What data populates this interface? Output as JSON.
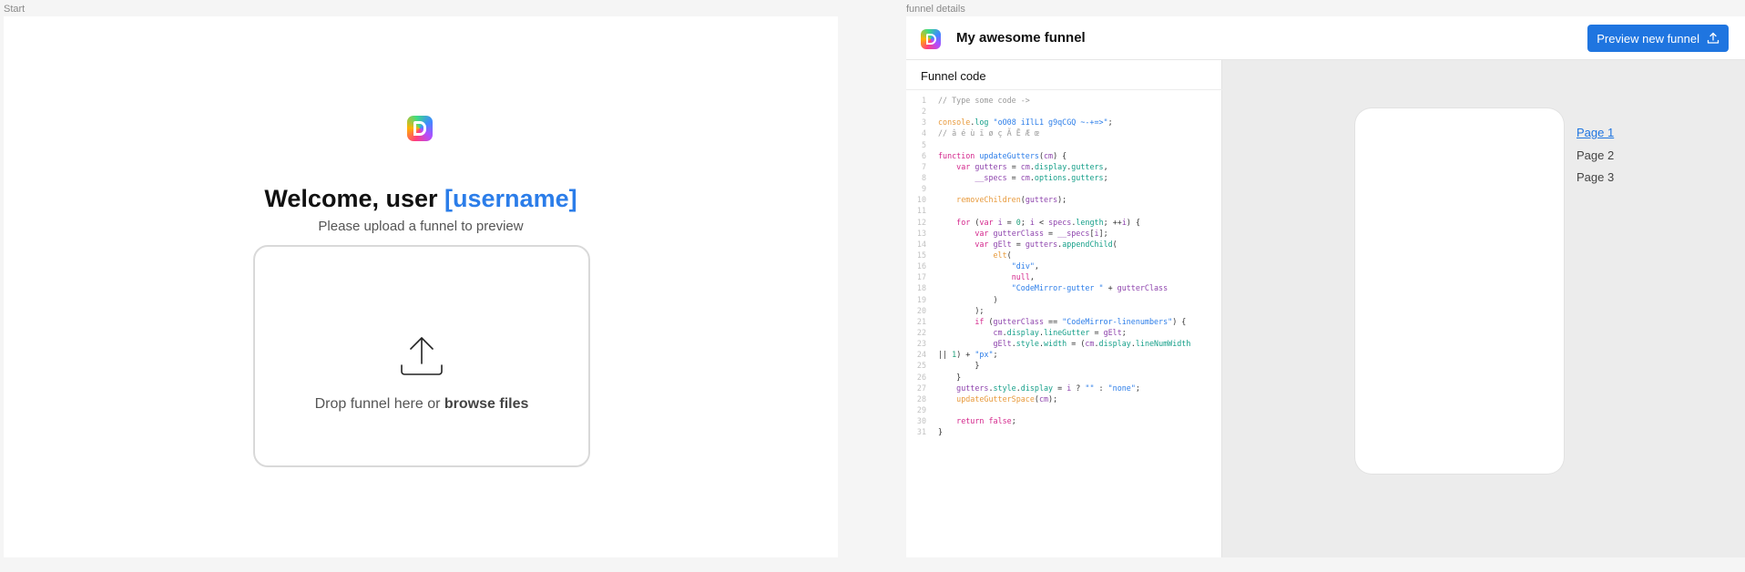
{
  "start": {
    "frame_label": "Start",
    "welcome_prefix": "Welcome, user",
    "username": "[username]",
    "subtitle": "Please upload a funnel to preview",
    "dropzone": {
      "text_prefix": "Drop funnel here or ",
      "browse_label": "browse files"
    }
  },
  "details": {
    "frame_label": "funnel details",
    "title": "My awesome funnel",
    "preview_button_label": "Preview new funnel",
    "code_panel_title": "Funnel code",
    "pages": [
      "Page 1",
      "Page 2",
      "Page 3"
    ],
    "active_page": "Page 1"
  },
  "code_lines": [
    "// Type some code ->",
    "",
    "console.log \"oO08 iIlL1 g9qCGQ ~-+=>\";",
    "// â é ù ï ø ç Ã Ē Æ œ",
    "",
    "function updateGutters(cm) {",
    "    var gutters = cm.display.gutters,",
    "        __specs = cm.options.gutters;",
    "",
    "    removeChildren(gutters);",
    "",
    "    for (var i = 0; i < specs.length; ++i) {",
    "        var gutterClass = __specs[i];",
    "        var gElt = gutters.appendChild(",
    "            elt(",
    "                \"div\",",
    "                null,",
    "                \"CodeMirror-gutter \" + gutterClass",
    "            )",
    "        );",
    "        if (gutterClass == \"CodeMirror-linenumbers\") {",
    "            cm.display.lineGutter = gElt;",
    "            gElt.style.width = (cm.display.lineNumWidth",
    "|| 1) + \"px\";",
    "        }",
    "    }",
    "    gutters.style.display = i ? \"\" : \"none\";",
    "    updateGutterSpace(cm);",
    "",
    "    return false;",
    "}"
  ],
  "colors": {
    "accent": "#1f75e0",
    "username": "#2b7de9",
    "keyword": "#d4278c",
    "property": "#17a08a",
    "function": "#e89a3c"
  },
  "icons": {
    "start_logo": "app-logo-icon",
    "upload": "upload-arrow-icon",
    "preview_button": "upload-icon"
  }
}
